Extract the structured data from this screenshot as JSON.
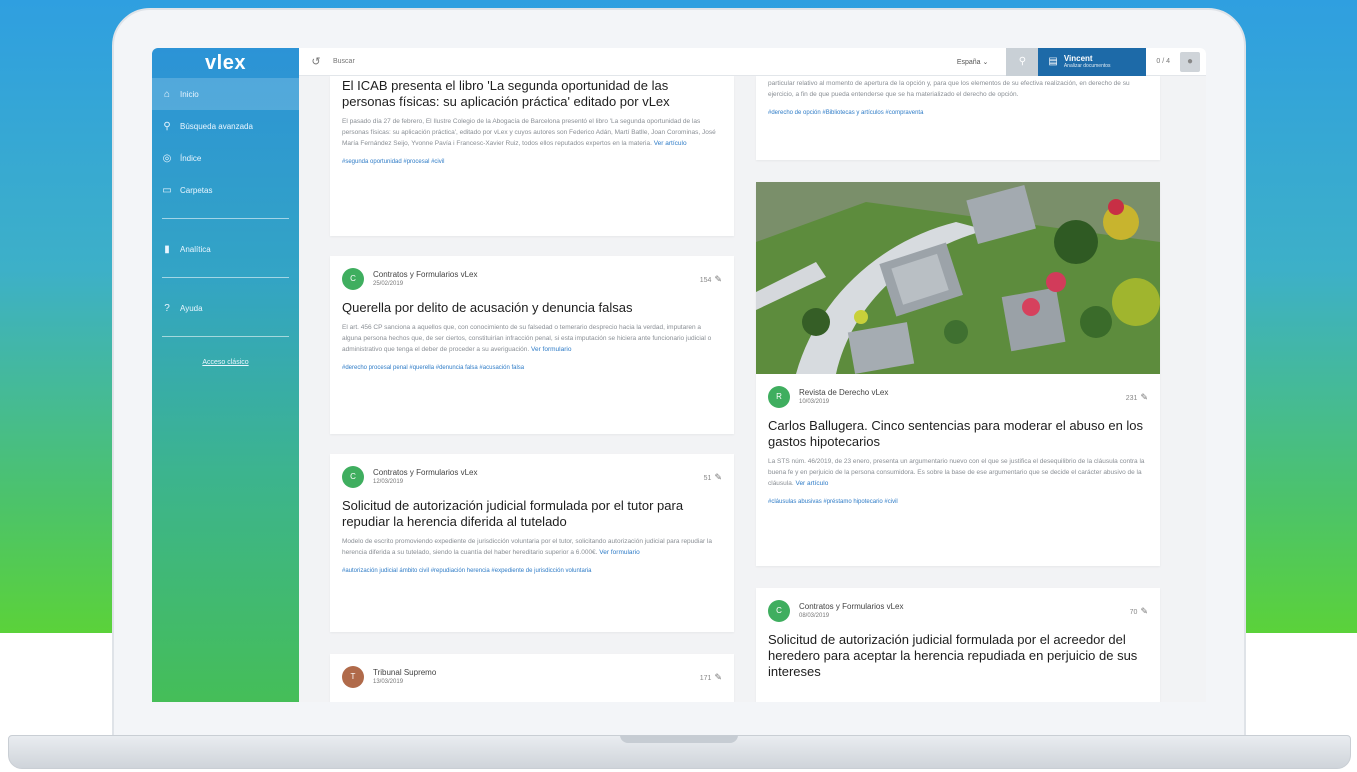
{
  "app": {
    "logo": "vlex"
  },
  "sidebar": {
    "items": [
      {
        "label": "Inicio",
        "icon": "home-icon"
      },
      {
        "label": "Búsqueda avanzada",
        "icon": "search-icon"
      },
      {
        "label": "Índice",
        "icon": "index-icon"
      },
      {
        "label": "Carpetas",
        "icon": "folder-icon"
      },
      {
        "label": "Analítica",
        "icon": "chart-icon"
      },
      {
        "label": "Ayuda",
        "icon": "help-icon"
      }
    ],
    "footer_link": "Acceso clásico"
  },
  "topbar": {
    "search_placeholder": "Buscar",
    "country": "España",
    "vincent_title": "Vincent",
    "vincent_sub": "Analizar documentos",
    "count": "0 / 4"
  },
  "cards": {
    "icab": {
      "title": "El ICAB presenta el libro 'La segunda oportunidad de las personas físicas: su aplicación práctica' editado por vLex",
      "excerpt": "El pasado día 27 de febrero, El Ilustre Colegio de la Abogacía de Barcelona presentó el libro 'La segunda oportunidad de las personas físicas: su aplicación práctica', editado por vLex y cuyos autores son Federico Adán, Martí Batlle, Joan Corominas, José María Fernández Seijo, Yvonne Pavía i Francesc-Xavier Ruiz, todos ellos reputados expertos en la materia.",
      "more": "Ver artículo",
      "tags": "#segunda oportunidad #procesal #civil"
    },
    "querella": {
      "source": "Contratos y Formularios vLex",
      "date": "25/02/2019",
      "views": "154",
      "title": "Querella por delito de acusación y denuncia falsas",
      "excerpt": "El art. 456 CP sanciona a aquellos que, con conocimiento de su falsedad o temerario desprecio hacia la verdad, imputaren a alguna persona hechos que, de ser ciertos, constituirían infracción penal, si esta imputación se hiciera ante funcionario judicial o administrativo que tenga el deber de proceder a su averiguación.",
      "more": "Ver formulario",
      "tags": "#derecho procesal penal #querella #denuncia falsa #acusación falsa"
    },
    "solicitud1": {
      "source": "Contratos y Formularios vLex",
      "date": "12/03/2019",
      "views": "51",
      "title": "Solicitud de autorización judicial formulada por el tutor para repudiar la herencia diferida al tutelado",
      "excerpt": "Modelo de escrito promoviendo expediente de jurisdicción voluntaria por el tutor, solicitando autorización judicial para repudiar la herencia diferida a su tutelado, siendo la cuantía del haber hereditario superior a 6.000€.",
      "more": "Ver formulario",
      "tags": "#autorización judicial ámbito civil #repudiación herencia #expediente de jurisdicción voluntaria"
    },
    "tribunal": {
      "source": "Tribunal Supremo",
      "date": "13/03/2019",
      "views": "171"
    },
    "top_right": {
      "excerpt": "particular relativo al momento de apertura de la opción y, para que los elementos de su efectiva realización, en derecho de su ejercicio, a fin de que pueda entenderse que se ha materializado el derecho de opción.",
      "tags": "#derecho de opción #Bibliotecas y artículos #compraventa"
    },
    "carlos": {
      "source": "Revista de Derecho vLex",
      "date": "10/03/2019",
      "views": "231",
      "title": "Carlos Ballugera. Cinco sentencias para moderar el abuso en los gastos hipotecarios",
      "excerpt": "La STS núm. 46/2019, de 23 enero, presenta un argumentario nuevo con el que se justifica el desequilibrio de la cláusula contra la buena fe y en perjuicio de la persona consumidora. Es sobre la base de ese argumentario que se decide el carácter abusivo de la cláusula.",
      "more": "Ver artículo",
      "tags": "#cláusulas abusivas #préstamo hipotecario #civil"
    },
    "solicitud2": {
      "source": "Contratos y Formularios vLex",
      "date": "08/03/2019",
      "views": "70",
      "title": "Solicitud de autorización judicial formulada por el acreedor del heredero para aceptar la herencia repudiada en perjuicio de sus intereses"
    }
  },
  "colors": {
    "sidebar_top": "#2c93d6",
    "sidebar_bottom": "#45be58",
    "vincent": "#1d6aa8",
    "link": "#2f7cc7",
    "avatar_green": "#3fae5f",
    "avatar_brown": "#b06a4a"
  }
}
